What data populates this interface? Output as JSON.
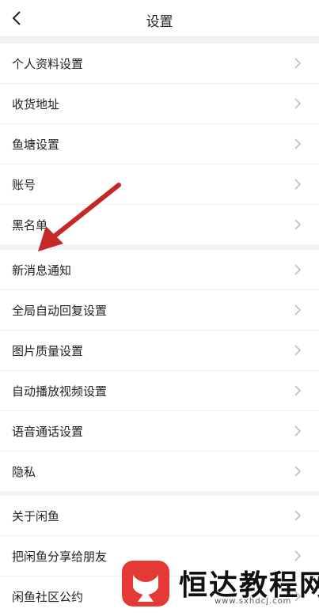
{
  "header": {
    "title": "设置"
  },
  "groups": [
    {
      "items": [
        "个人资料设置",
        "收货地址",
        "鱼塘设置",
        "账号",
        "黑名单"
      ]
    },
    {
      "items": [
        "新消息通知",
        "全局自动回复设置",
        "图片质量设置",
        "自动播放视频设置",
        "语音通话设置",
        "隐私"
      ]
    },
    {
      "items": [
        "关于闲鱼",
        "把闲鱼分享给朋友",
        "闲鱼社区公约"
      ]
    }
  ],
  "watermark": {
    "brand": "恒达教程网",
    "url": "www.sxhdcj.com"
  },
  "colors": {
    "accent_arrow": "#c62828",
    "watermark_logo": "#e53935"
  },
  "icons": {
    "back": "chevron-left-icon",
    "row_chevron": "chevron-right-icon"
  }
}
